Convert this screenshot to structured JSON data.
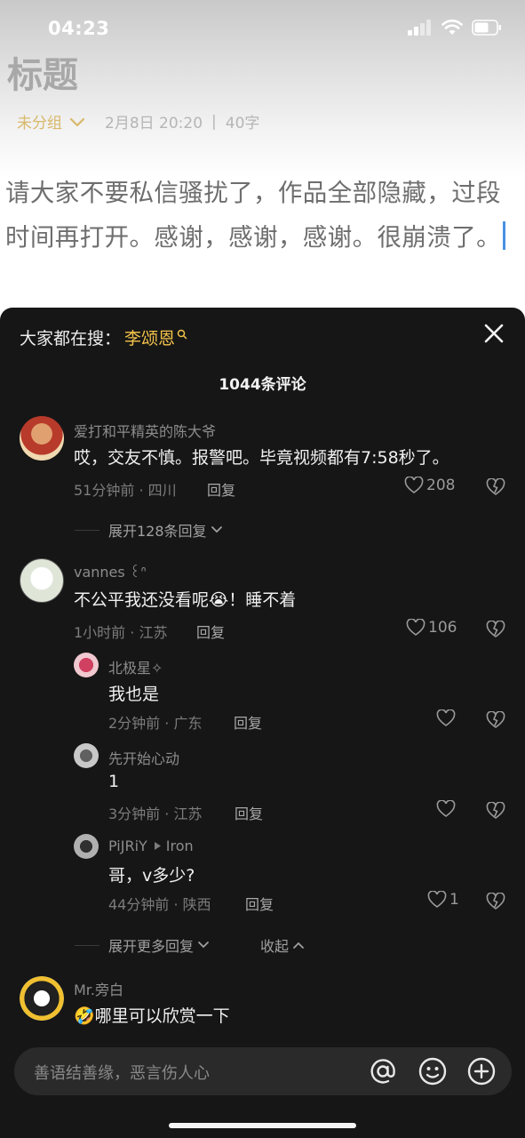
{
  "status": {
    "time": "04:23"
  },
  "note": {
    "title": "标题",
    "group": "未分组",
    "date": "2月8日 20:20",
    "separator": "|",
    "word_count": "40字",
    "body_line1": "请大家不要私信骚扰了，作品全部隐藏，过段",
    "body_line2": "时间再打开。感谢，感谢，感谢。很崩溃了。"
  },
  "sheet": {
    "search_prefix": "大家都在搜：",
    "search_term": "李颂恩",
    "count": "1044条评论"
  },
  "comments": [
    {
      "name": "爱打和平精英的陈大爷",
      "text": "哎，交友不慎。报警吧。毕竟视频都有7:58秒了。",
      "meta": "51分钟前 · 四川",
      "reply": "回复",
      "likes": "208",
      "expand": "展开128条回复"
    },
    {
      "name": "vannes ꒰ᐢ ",
      "text": "不公平我还没看呢😭！睡不着",
      "meta": "1小时前 · 江苏",
      "reply": "回复",
      "likes": "106"
    },
    {
      "name": "北极星✧",
      "text": "我也是",
      "meta": "2分钟前 · 广东",
      "reply": "回复",
      "likes": ""
    },
    {
      "name": "先开始心动",
      "text": "1",
      "meta": "3分钟前 · 江苏",
      "reply": "回复",
      "likes": ""
    },
    {
      "name": "PiJRiY",
      "reply_to": "Iron",
      "text": "哥，v多少?",
      "meta": "44分钟前 · 陕西",
      "reply": "回复",
      "likes": "1"
    },
    {
      "name": "Mr.旁白",
      "text": "🤣哪里可以欣赏一下"
    }
  ],
  "thread_controls": {
    "expand_more": "展开更多回复",
    "collapse": "收起"
  },
  "input": {
    "placeholder": "善语结善缘，恶言伤人心"
  },
  "colors": {
    "accent_yellow": "#f2c24a",
    "sheet_bg": "#161616",
    "cursor_blue": "#4a90e2"
  }
}
